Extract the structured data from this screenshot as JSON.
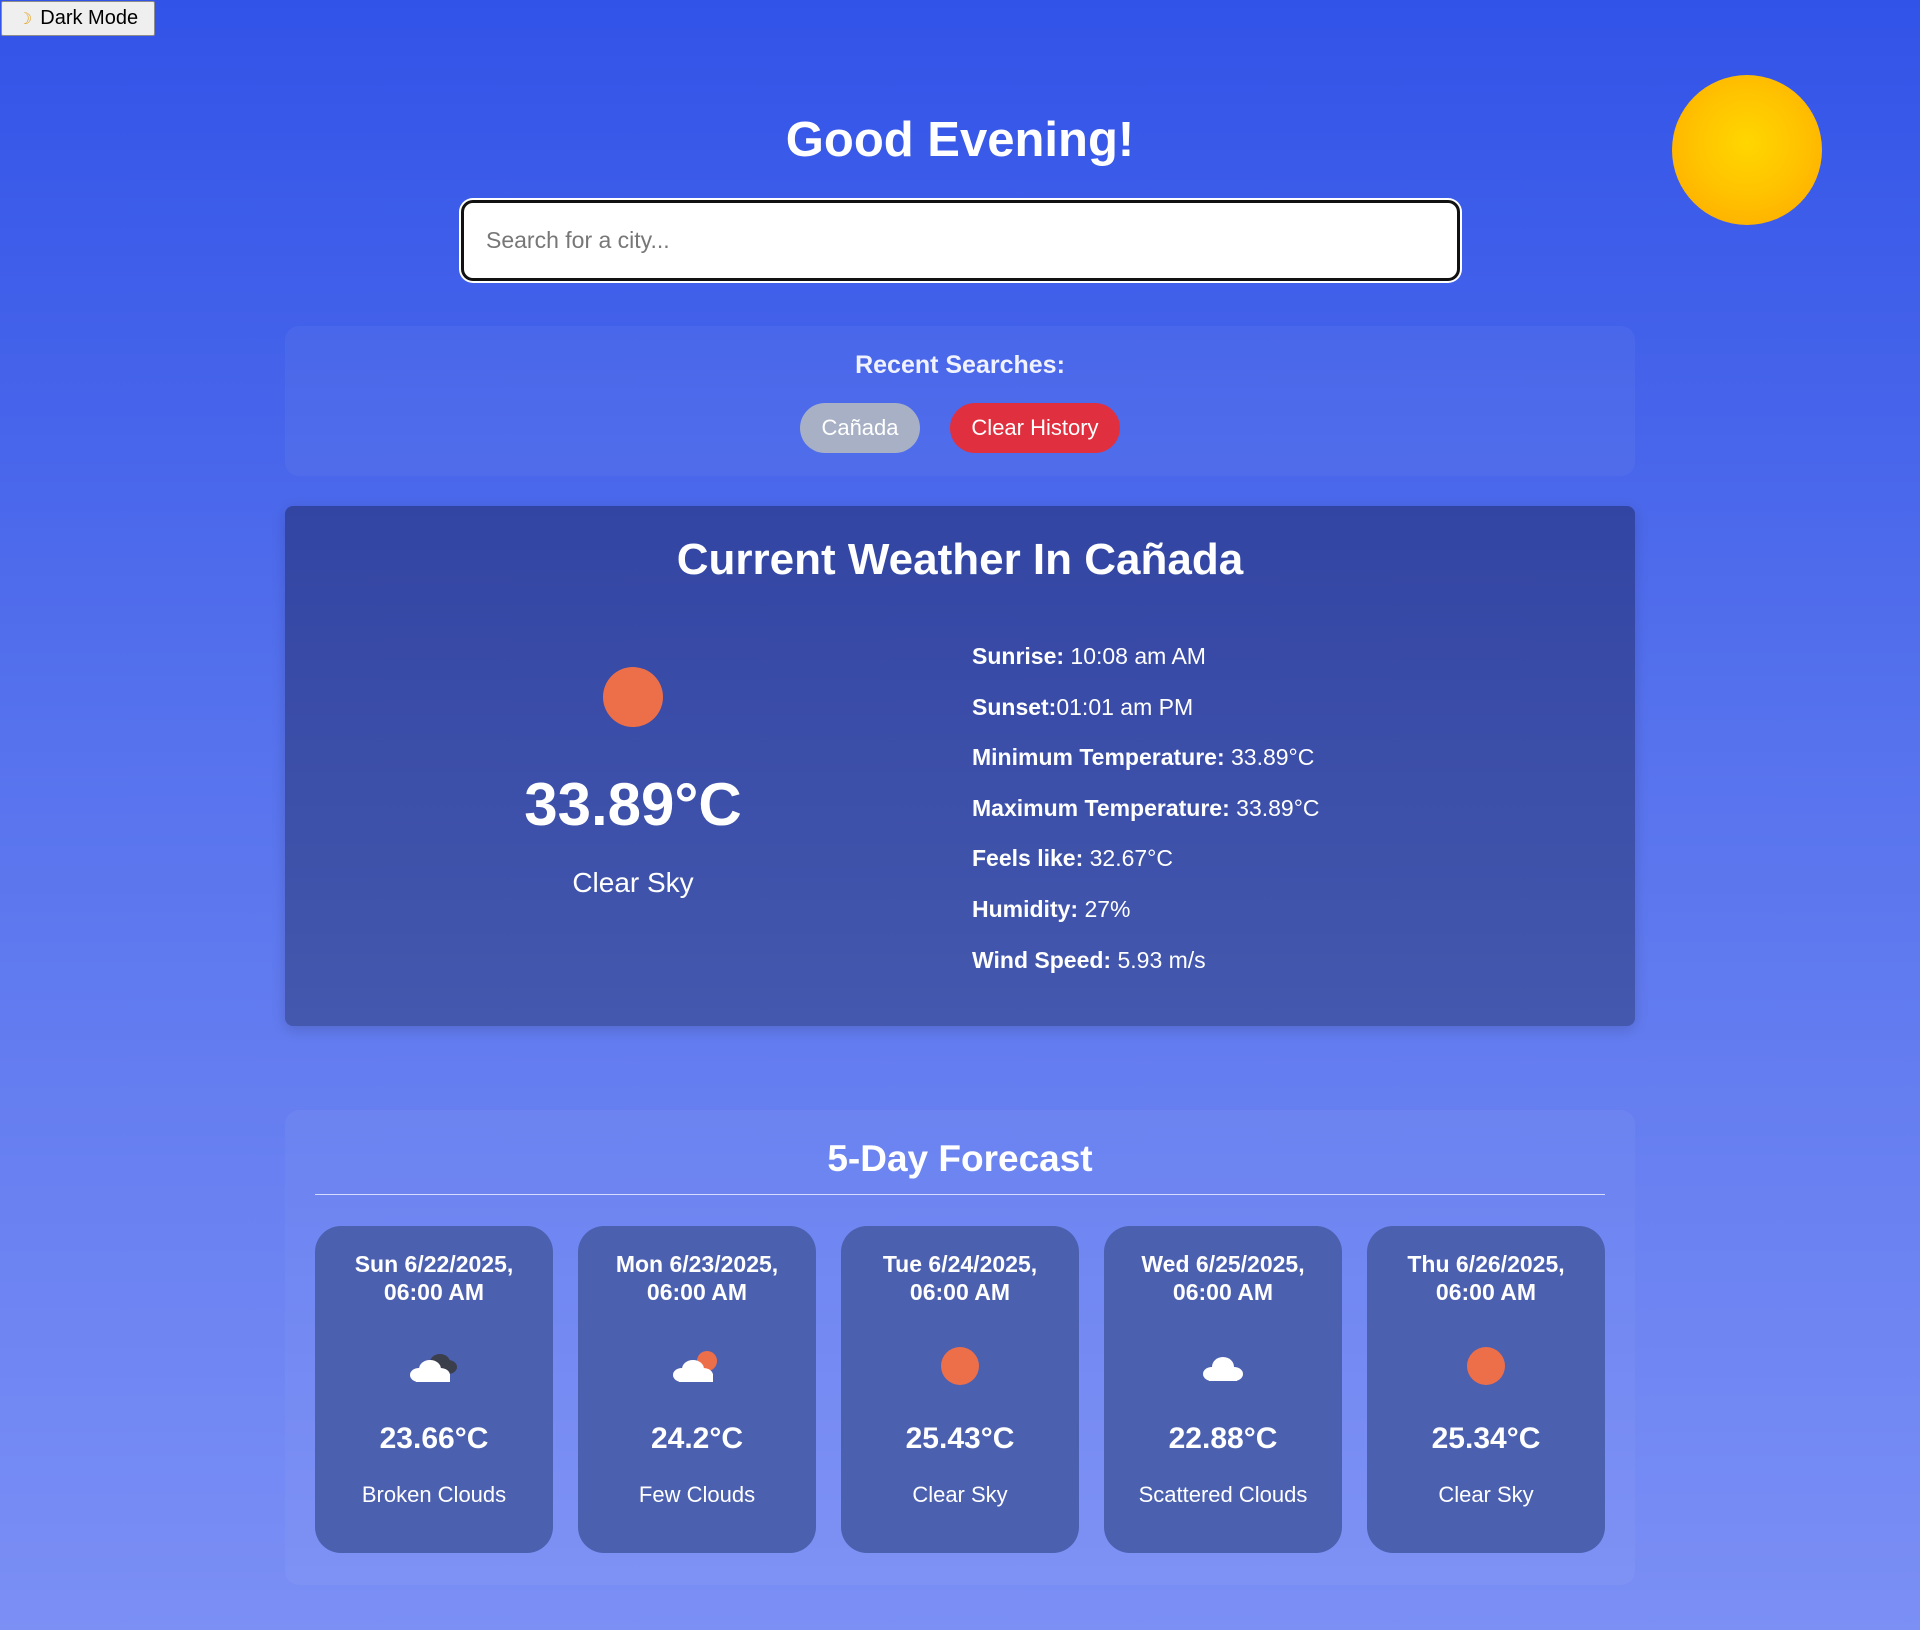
{
  "theme_toggle": {
    "icon": "moon-icon",
    "label": "Dark Mode"
  },
  "greeting": "Good Evening!",
  "search": {
    "placeholder": "Search for a city...",
    "value": ""
  },
  "recent": {
    "title": "Recent Searches:",
    "items": [
      "Cañada"
    ],
    "clear_label": "Clear History"
  },
  "current": {
    "title": "Current Weather In Cañada",
    "icon": "sun-icon",
    "temperature": "33.89°C",
    "description": "Clear Sky",
    "details": [
      {
        "label": "Sunrise:",
        "value": " 10:08 am AM"
      },
      {
        "label": "Sunset:",
        "value": "01:01 am PM"
      },
      {
        "label": "Minimum Temperature:",
        "value": " 33.89°C"
      },
      {
        "label": "Maximum Temperature:",
        "value": " 33.89°C"
      },
      {
        "label": "Feels like:",
        "value": " 32.67°C"
      },
      {
        "label": "Humidity:",
        "value": " 27%"
      },
      {
        "label": "Wind Speed:",
        "value": " 5.93 m/s"
      }
    ]
  },
  "forecast": {
    "title": "5-Day Forecast",
    "days": [
      {
        "date_line1": "Sun 6/22/2025,",
        "date_line2": "06:00 AM",
        "icon": "broken-clouds-icon",
        "temp": "23.66°C",
        "desc": "Broken Clouds"
      },
      {
        "date_line1": "Mon 6/23/2025,",
        "date_line2": "06:00 AM",
        "icon": "few-clouds-icon",
        "temp": "24.2°C",
        "desc": "Few Clouds"
      },
      {
        "date_line1": "Tue 6/24/2025,",
        "date_line2": "06:00 AM",
        "icon": "sun-icon",
        "temp": "25.43°C",
        "desc": "Clear Sky"
      },
      {
        "date_line1": "Wed 6/25/2025,",
        "date_line2": "06:00 AM",
        "icon": "cloud-icon",
        "temp": "22.88°C",
        "desc": "Scattered Clouds"
      },
      {
        "date_line1": "Thu 6/26/2025,",
        "date_line2": "06:00 AM",
        "icon": "sun-icon",
        "temp": "25.34°C",
        "desc": "Clear Sky"
      }
    ]
  },
  "colors": {
    "background_top": "#3253e8",
    "background_bottom": "#7b8ff5",
    "card": "#4c60b0",
    "sun": "#ed6f4a",
    "clear_button": "#e0303f",
    "city_chip": "#a7b0c5"
  }
}
